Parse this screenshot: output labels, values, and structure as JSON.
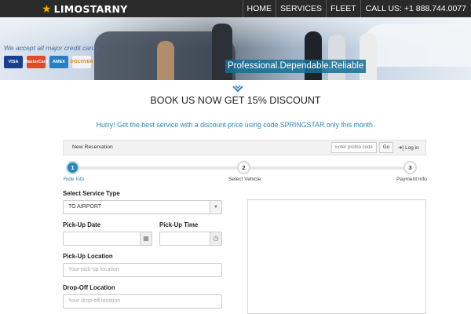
{
  "header": {
    "logo_text": "LIMOSTARNY",
    "nav": [
      "HOME",
      "SERVICES",
      "FLEET",
      "CALL US: +1 888.744.0077"
    ]
  },
  "banner": {
    "cards_text": "We accept all major credit cards",
    "cards": [
      "VISA",
      "MasterCard",
      "AMEX",
      "DISCOVER"
    ],
    "slogan": "Professional.Dependable.Reliable"
  },
  "main": {
    "title": "BOOK US NOW GET 15% DISCOUNT",
    "promo_message": "Hurry! Get the best service with a discount price using code SPRINGSTAR only this month."
  },
  "reservation": {
    "panel_title": "New Reservation",
    "promo_placeholder": "Enter promo code",
    "go_label": "Go",
    "login_label": "Log in"
  },
  "steps": [
    {
      "number": "1",
      "label": "Ride Info"
    },
    {
      "number": "2",
      "label": "Select Vehicle"
    },
    {
      "number": "3",
      "label": "Payment Info"
    }
  ],
  "form": {
    "service_type_label": "Select Service Type",
    "service_type_value": "TO AIRPORT",
    "pickup_date_label": "Pick-Up Date",
    "pickup_time_label": "Pick-Up Time",
    "pickup_location_label": "Pick-Up Location",
    "pickup_location_placeholder": "Your pick-up location",
    "dropoff_location_label": "Drop-Off Location",
    "dropoff_location_placeholder": "Your drop-off location"
  },
  "icons": {
    "logo": "star-icon",
    "login": "sign-in-icon",
    "date": "calendar-icon",
    "time": "clock-icon",
    "select": "caret-down-icon"
  },
  "colors": {
    "accent": "#2a86b8",
    "nav_bg": "#2a2a2a",
    "logo_star": "#e8b100"
  }
}
